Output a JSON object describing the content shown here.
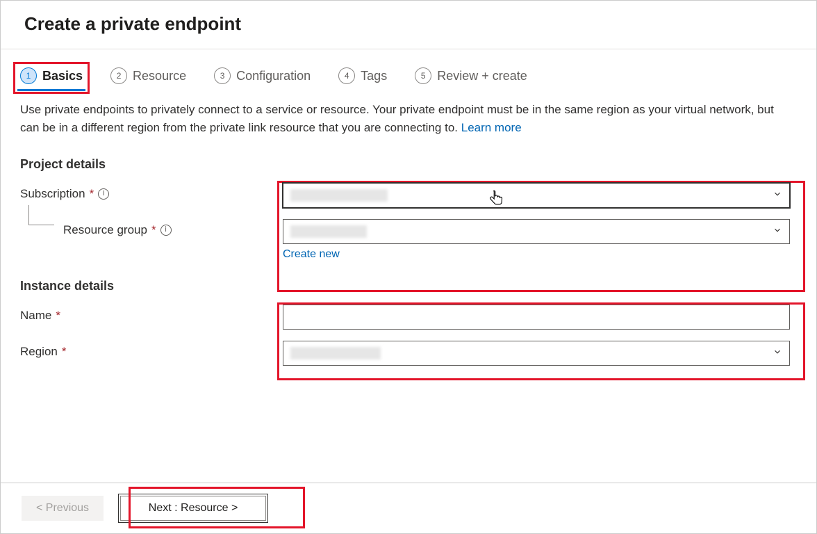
{
  "header": {
    "title": "Create a private endpoint"
  },
  "tabs": [
    {
      "num": "1",
      "label": "Basics"
    },
    {
      "num": "2",
      "label": "Resource"
    },
    {
      "num": "3",
      "label": "Configuration"
    },
    {
      "num": "4",
      "label": "Tags"
    },
    {
      "num": "5",
      "label": "Review + create"
    }
  ],
  "intro": {
    "text": "Use private endpoints to privately connect to a service or resource. Your private endpoint must be in the same region as your virtual network, but can be in a different region from the private link resource that you are connecting to.  ",
    "link": "Learn more"
  },
  "sections": {
    "project": {
      "title": "Project details",
      "subscription_label": "Subscription",
      "resource_group_label": "Resource group",
      "create_new": "Create new"
    },
    "instance": {
      "title": "Instance details",
      "name_label": "Name",
      "region_label": "Region"
    }
  },
  "footer": {
    "previous": "< Previous",
    "next": "Next : Resource >"
  },
  "required_marker": "*"
}
